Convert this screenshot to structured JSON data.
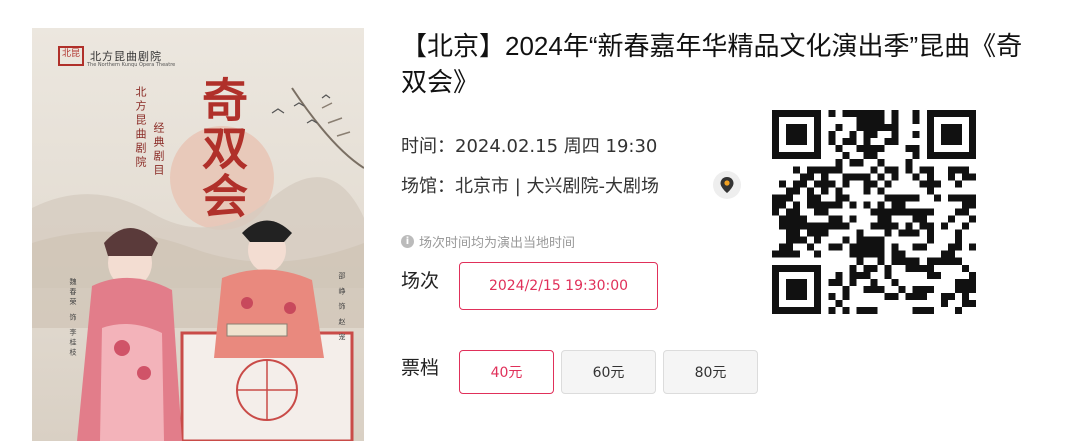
{
  "poster": {
    "brand_seal": "北昆",
    "brand_name": "北方昆曲剧院",
    "brand_en": "The Northern Kunqu Opera Theatre",
    "title": "奇双会",
    "side_text_1": "北方昆曲剧院",
    "side_text_2": "经典剧目",
    "cast_left": "魏春荣 饰 李桂枝",
    "cast_right": "邵 峥 饰 赵 宠"
  },
  "event": {
    "title": "【北京】2024年“新春嘉年华精品文化演出季”昆曲《奇双会》",
    "time_label": "时间：",
    "time_value": "2024.02.15 周四 19:30",
    "venue_label": "场馆：",
    "venue_value": "北京市 | 大兴剧院-大剧场",
    "hint": "场次时间均为演出当地时间"
  },
  "session": {
    "label": "场次",
    "options": [
      "2024/2/15 19:30:00"
    ],
    "selected": "2024/2/15 19:30:00"
  },
  "ticket": {
    "label": "票档",
    "options": [
      "40元",
      "60元",
      "80元"
    ],
    "selected": "40元"
  },
  "colors": {
    "accent": "#e0305a",
    "poster_red": "#b0302a"
  },
  "icons": {
    "map": "map-pin-icon",
    "info": "info-icon",
    "qr": "qr-code"
  }
}
